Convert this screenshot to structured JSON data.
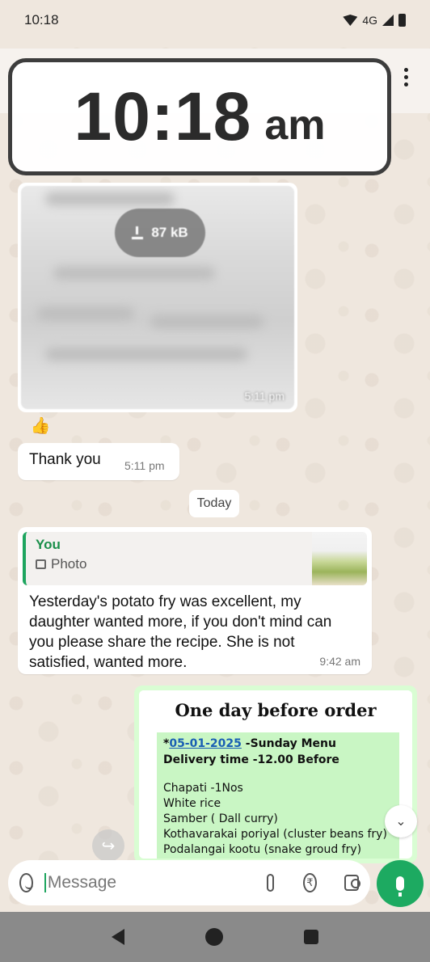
{
  "status_bar": {
    "time": "10:18",
    "network": "4G"
  },
  "clock_overlay": {
    "time": "10:18",
    "ampm": "am"
  },
  "image_message": {
    "size_label": "87 kB",
    "time": "5:11 pm",
    "reaction": "👍"
  },
  "thanks_message": {
    "text": "Thank you",
    "time": "5:11 pm"
  },
  "date_chip": "Today",
  "reply_message": {
    "quote_author": "You",
    "quote_type": "Photo",
    "text": "Yesterday's potato fry was excellent, my daughter wanted more, if you don't mind can you please share the recipe. She is not satisfied, wanted more.",
    "time": "9:42 am"
  },
  "menu_card": {
    "header": "One day before order",
    "date": "05-01-2025",
    "date_prefix": "*",
    "day_label": " -Sunday Menu",
    "delivery": "Delivery time -12.00 Before",
    "items": [
      "Chapati -1Nos",
      "White rice",
      "Samber ( Dall curry)",
      "Kothavarakai poriyal (cluster beans fry)",
      "Podalangai kootu (snake groud fry)"
    ]
  },
  "input_bar": {
    "placeholder": "Message"
  },
  "icons": {
    "emoji": "emoji-icon",
    "attach": "paperclip-icon",
    "payment": "rupee-icon",
    "camera": "camera-icon",
    "mic": "mic-icon"
  },
  "colors": {
    "accent_green": "#1daa61",
    "outgoing_bubble": "#d9fdd3",
    "link_blue": "#1a5fb4"
  }
}
